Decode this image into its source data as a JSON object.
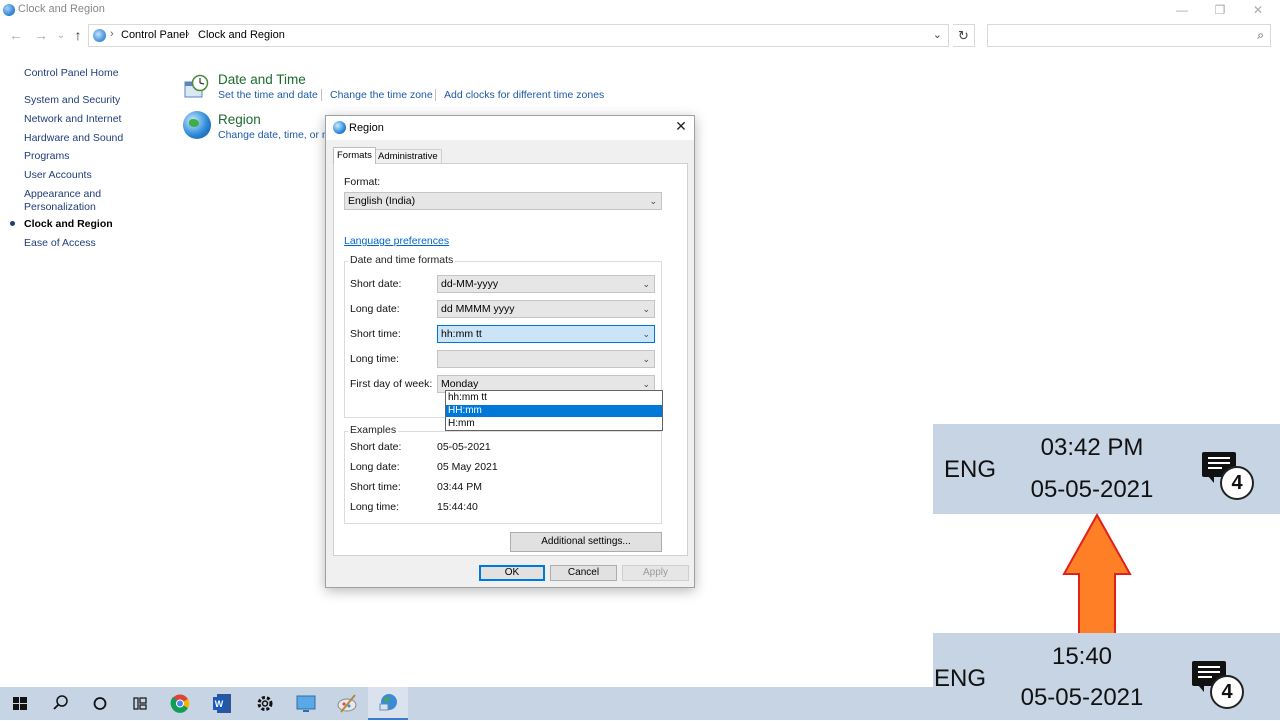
{
  "window": {
    "title": "Clock and Region",
    "controls": {
      "minimize": "—",
      "restore": "❐",
      "close": "✕"
    }
  },
  "address_bar": {
    "back": "←",
    "forward": "→",
    "recent": "⌄",
    "up": "↑",
    "crumbs": [
      "Control Panel",
      "Clock and Region"
    ],
    "separator": "›",
    "dropdown": "⌄",
    "refresh": "↻",
    "search_placeholder": "",
    "search_icon": "⌕"
  },
  "sidebar": {
    "home": "Control Panel Home",
    "items": [
      "System and Security",
      "Network and Internet",
      "Hardware and Sound",
      "Programs",
      "User Accounts",
      "Appearance and",
      "Personalization",
      "Clock and Region",
      "Ease of Access"
    ]
  },
  "content": {
    "date_time": {
      "title": "Date and Time",
      "links": [
        "Set the time and date",
        "Change the time zone",
        "Add clocks for different time zones"
      ]
    },
    "region": {
      "title": "Region",
      "link_visible": "Change date, time, or nu"
    }
  },
  "dialog": {
    "title": "Region",
    "close": "✕",
    "tabs": [
      "Formats",
      "Administrative"
    ],
    "format_label": "Format:",
    "format_value": "English (India)",
    "language_link": "Language preferences",
    "dt_group_title": "Date and time formats",
    "rows": {
      "short_date": {
        "label": "Short date:",
        "value": "dd-MM-yyyy"
      },
      "long_date": {
        "label": "Long date:",
        "value": "dd MMMM yyyy"
      },
      "short_time": {
        "label": "Short time:",
        "value": "hh:mm tt"
      },
      "long_time": {
        "label": "Long time:"
      },
      "first_day": {
        "label": "First day of week:",
        "value": "Monday"
      }
    },
    "short_time_options": [
      "hh:mm tt",
      "HH:mm",
      "H:mm"
    ],
    "short_time_highlighted": "HH:mm",
    "examples": {
      "title": "Examples",
      "rows": [
        {
          "label": "Short date:",
          "value": "05-05-2021"
        },
        {
          "label": "Long date:",
          "value": "05 May 2021"
        },
        {
          "label": "Short time:",
          "value": "03:44 PM"
        },
        {
          "label": "Long time:",
          "value": "15:44:40"
        }
      ]
    },
    "additional_settings": "Additional settings...",
    "buttons": {
      "ok": "OK",
      "cancel": "Cancel",
      "apply": "Apply"
    }
  },
  "zoom_before": {
    "lang": "ENG",
    "time": "03:42 PM",
    "date": "05-05-2021",
    "notifications": "4"
  },
  "zoom_after": {
    "lang": "ENG",
    "time": "15:40",
    "date": "05-05-2021",
    "notifications": "4"
  },
  "colors": {
    "taskbar": "#c7d4e4",
    "arrow_fill": "#ff7f27",
    "arrow_stroke": "#e0201b",
    "highlight": "#0078d7"
  },
  "taskbar": {
    "icons": [
      "windows-start-icon",
      "search-icon",
      "cortana-icon",
      "task-view-icon",
      "chrome-icon",
      "word-icon",
      "settings-icon",
      "remote-desktop-icon",
      "paint-icon",
      "control-panel-icon"
    ]
  }
}
